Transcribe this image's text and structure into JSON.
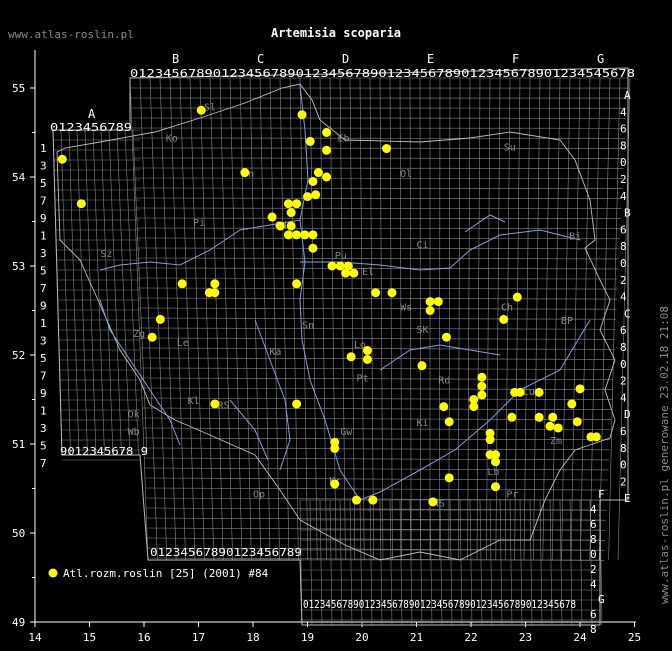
{
  "site": "www.atlas-roslin.pl",
  "title": "Artemisia scoparia",
  "side_note": "www.atlas-roslin.pl generowane 23.02.18 21:08",
  "legend": {
    "label": "Atl.rozm.roslin [25] (2001) #84",
    "color": "#ffff00"
  },
  "axes": {
    "x_ticks": [
      "14",
      "15",
      "16",
      "17",
      "18",
      "19",
      "20",
      "21",
      "22",
      "23",
      "24",
      "25"
    ],
    "y_ticks": [
      "55",
      "54",
      "53",
      "52",
      "51",
      "50",
      "49"
    ],
    "lon_range": [
      14,
      25
    ],
    "lat_range": [
      49,
      55.5
    ]
  },
  "grid": {
    "top_letters": [
      "B",
      "C",
      "D",
      "E",
      "F",
      "G"
    ],
    "top_digits": "0123456789012345678901234567890123456789012345678901234545678",
    "bottom1_digits": "01234567890123456789",
    "bottom2_digits": "0123456789012345678901234567890123456789012345678",
    "west_letter": "A",
    "west_top_digits": "0123456789",
    "west_bottom_digits": "9012345678 9",
    "east_labels": [
      {
        "t": "A",
        "c": "#fff"
      },
      {
        "t": "4",
        "c": "#fff"
      },
      {
        "t": "6",
        "c": "#fff"
      },
      {
        "t": "8",
        "c": "#fff"
      },
      {
        "t": "0",
        "c": "#fff"
      },
      {
        "t": "2",
        "c": "#fff"
      },
      {
        "t": "4",
        "c": "#fff"
      },
      {
        "t": "B",
        "c": "#fff"
      },
      {
        "t": "6",
        "c": "#fff"
      },
      {
        "t": "8",
        "c": "#fff"
      },
      {
        "t": "0",
        "c": "#fff"
      },
      {
        "t": "2",
        "c": "#fff"
      },
      {
        "t": "4",
        "c": "#fff"
      },
      {
        "t": "C",
        "c": "#fff"
      },
      {
        "t": "6",
        "c": "#fff"
      },
      {
        "t": "8",
        "c": "#fff"
      },
      {
        "t": "0",
        "c": "#fff"
      },
      {
        "t": "2",
        "c": "#fff"
      },
      {
        "t": "4",
        "c": "#fff"
      },
      {
        "t": "D",
        "c": "#fff"
      },
      {
        "t": "6",
        "c": "#fff"
      },
      {
        "t": "8",
        "c": "#fff"
      },
      {
        "t": "0",
        "c": "#fff"
      },
      {
        "t": "2",
        "c": "#fff"
      },
      {
        "t": "E",
        "c": "#fff"
      }
    ],
    "west_side_digits": [
      "1",
      "3",
      "5",
      "7",
      "9",
      "1",
      "3",
      "5",
      "7",
      "9",
      "1",
      "3",
      "5",
      "7",
      "9",
      "1",
      "3",
      "5",
      "7"
    ],
    "se_letters": [
      "F",
      "4",
      "6",
      "8",
      "0",
      "2",
      "4",
      "G",
      "6",
      "8"
    ]
  },
  "regions": [
    "Sl",
    "Ko",
    "Eb",
    "Su",
    "Ol",
    "Bi",
    "Gd",
    "Pi",
    "Ci",
    "Pu",
    "Ws",
    "Le",
    "SK",
    "Zg",
    "Lo",
    "Ka",
    "Lu",
    "Pt",
    "Rd",
    "Kl",
    "BP",
    "Zm",
    "Wb",
    "Ok",
    "Ch",
    "Ki",
    "RS",
    "NS",
    "Kr",
    "Lb",
    "Pr",
    "Sz",
    "Op",
    "Gw",
    "El",
    "Bn",
    "Sn"
  ],
  "points": [
    [
      14.5,
      54.2
    ],
    [
      14.85,
      53.7
    ],
    [
      17.05,
      54.75
    ],
    [
      17.85,
      54.05
    ],
    [
      18.9,
      54.7
    ],
    [
      19.35,
      54.5
    ],
    [
      19.05,
      54.4
    ],
    [
      19.35,
      54.3
    ],
    [
      20.45,
      54.32
    ],
    [
      19.2,
      54.05
    ],
    [
      19.35,
      54.0
    ],
    [
      19.1,
      53.95
    ],
    [
      19.0,
      53.78
    ],
    [
      19.15,
      53.8
    ],
    [
      18.8,
      53.7
    ],
    [
      18.7,
      53.6
    ],
    [
      18.65,
      53.7
    ],
    [
      18.35,
      53.55
    ],
    [
      18.5,
      53.45
    ],
    [
      18.7,
      53.45
    ],
    [
      18.65,
      53.35
    ],
    [
      18.8,
      53.35
    ],
    [
      18.95,
      53.35
    ],
    [
      19.1,
      53.35
    ],
    [
      19.1,
      53.2
    ],
    [
      19.45,
      53.0
    ],
    [
      19.6,
      53.0
    ],
    [
      19.75,
      53.0
    ],
    [
      19.7,
      52.92
    ],
    [
      19.85,
      52.92
    ],
    [
      16.7,
      52.8
    ],
    [
      17.3,
      52.8
    ],
    [
      17.2,
      52.7
    ],
    [
      17.3,
      52.7
    ],
    [
      18.8,
      52.8
    ],
    [
      20.25,
      52.7
    ],
    [
      20.55,
      52.7
    ],
    [
      21.25,
      52.6
    ],
    [
      21.4,
      52.6
    ],
    [
      21.25,
      52.5
    ],
    [
      22.85,
      52.65
    ],
    [
      22.6,
      52.4
    ],
    [
      16.3,
      52.4
    ],
    [
      16.15,
      52.2
    ],
    [
      21.55,
      52.2
    ],
    [
      20.1,
      52.05
    ],
    [
      19.8,
      51.98
    ],
    [
      20.1,
      51.95
    ],
    [
      21.1,
      51.88
    ],
    [
      22.2,
      51.75
    ],
    [
      22.2,
      51.65
    ],
    [
      22.2,
      51.55
    ],
    [
      22.8,
      51.58
    ],
    [
      22.9,
      51.58
    ],
    [
      23.25,
      51.58
    ],
    [
      24.0,
      51.62
    ],
    [
      22.05,
      51.5
    ],
    [
      22.05,
      51.42
    ],
    [
      17.3,
      51.45
    ],
    [
      18.8,
      51.45
    ],
    [
      21.5,
      51.42
    ],
    [
      22.75,
      51.3
    ],
    [
      23.25,
      51.3
    ],
    [
      23.5,
      51.3
    ],
    [
      23.85,
      51.45
    ],
    [
      23.45,
      51.2
    ],
    [
      23.6,
      51.18
    ],
    [
      23.95,
      51.25
    ],
    [
      21.6,
      51.25
    ],
    [
      22.35,
      51.12
    ],
    [
      22.35,
      51.05
    ],
    [
      19.5,
      51.02
    ],
    [
      19.5,
      50.95
    ],
    [
      22.35,
      50.88
    ],
    [
      22.45,
      50.88
    ],
    [
      22.45,
      50.8
    ],
    [
      21.6,
      50.62
    ],
    [
      22.45,
      50.52
    ],
    [
      19.5,
      50.55
    ],
    [
      19.9,
      50.37
    ],
    [
      20.2,
      50.37
    ],
    [
      21.3,
      50.35
    ],
    [
      24.2,
      51.08
    ],
    [
      24.3,
      51.08
    ]
  ]
}
